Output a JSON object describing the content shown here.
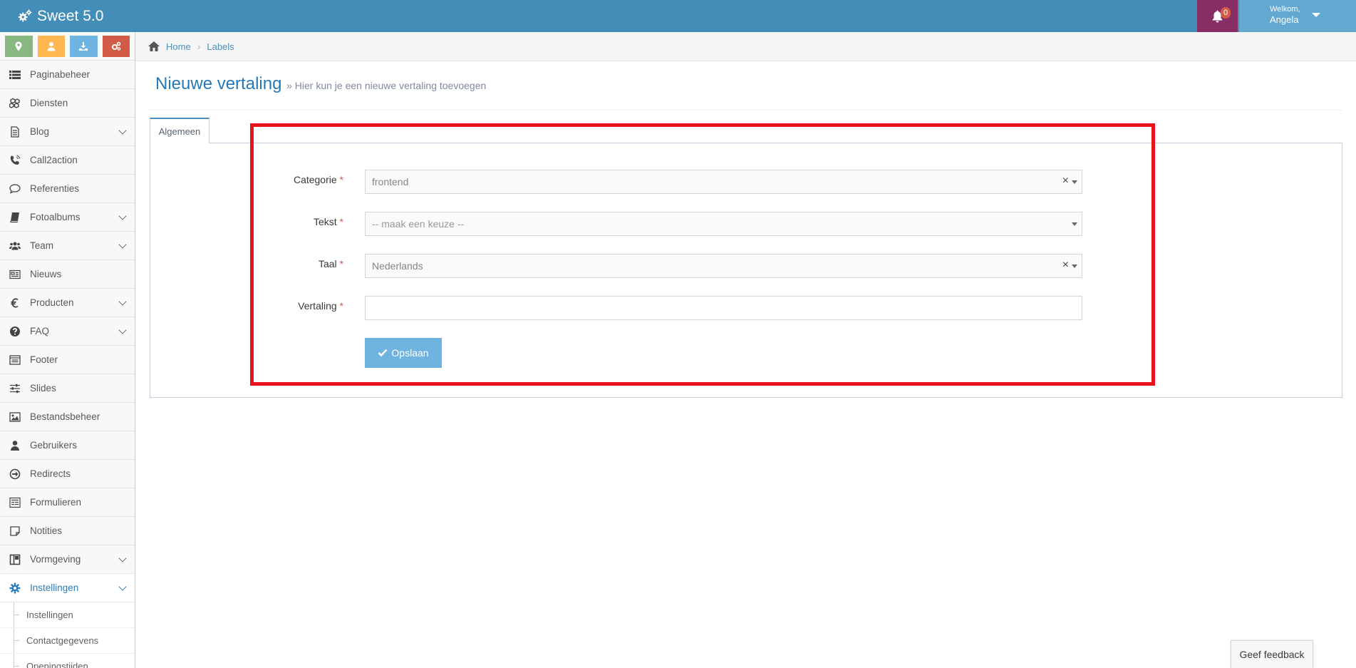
{
  "header": {
    "brand": "Sweet 5.0",
    "notification_count": "0",
    "welcome": "Welkom,",
    "user_name": "Angela"
  },
  "shortcuts": [
    {
      "icon": "map-marker-icon",
      "color": "#87b87f"
    },
    {
      "icon": "user-icon",
      "color": "#ffb752"
    },
    {
      "icon": "download-icon",
      "color": "#6fb3e0"
    },
    {
      "icon": "cogs-icon",
      "color": "#d15b47"
    }
  ],
  "sidebar": {
    "items": [
      {
        "label": "Paginabeheer",
        "icon": "list-icon",
        "has_submenu": false
      },
      {
        "label": "Diensten",
        "icon": "cubes-icon",
        "has_submenu": false
      },
      {
        "label": "Blog",
        "icon": "file-text-icon",
        "has_submenu": true
      },
      {
        "label": "Call2action",
        "icon": "phone-volume-icon",
        "has_submenu": false
      },
      {
        "label": "Referenties",
        "icon": "comment-icon",
        "has_submenu": false
      },
      {
        "label": "Fotoalbums",
        "icon": "book-icon",
        "has_submenu": true
      },
      {
        "label": "Team",
        "icon": "users-icon",
        "has_submenu": true
      },
      {
        "label": "Nieuws",
        "icon": "newspaper-icon",
        "has_submenu": false
      },
      {
        "label": "Producten",
        "icon": "euro-icon",
        "has_submenu": true
      },
      {
        "label": "FAQ",
        "icon": "question-circle-icon",
        "has_submenu": true
      },
      {
        "label": "Footer",
        "icon": "window-icon",
        "has_submenu": false
      },
      {
        "label": "Slides",
        "icon": "sliders-icon",
        "has_submenu": false
      },
      {
        "label": "Bestandsbeheer",
        "icon": "image-icon",
        "has_submenu": false
      },
      {
        "label": "Gebruikers",
        "icon": "user-icon",
        "has_submenu": false
      },
      {
        "label": "Redirects",
        "icon": "arrow-circle-icon",
        "has_submenu": false
      },
      {
        "label": "Formulieren",
        "icon": "form-icon",
        "has_submenu": false
      },
      {
        "label": "Notities",
        "icon": "sticky-note-icon",
        "has_submenu": false
      },
      {
        "label": "Vormgeving",
        "icon": "columns-icon",
        "has_submenu": true
      },
      {
        "label": "Instellingen",
        "icon": "gear-icon",
        "has_submenu": true,
        "active": true
      }
    ],
    "subitems": [
      "Instellingen",
      "Contactgegevens",
      "Openingstijden"
    ]
  },
  "breadcrumb": {
    "home": "Home",
    "current": "Labels"
  },
  "page": {
    "title": "Nieuwe vertaling",
    "subtitle": "» Hier kun je een nieuwe vertaling toevoegen"
  },
  "tabs": [
    {
      "label": "Algemeen"
    }
  ],
  "form": {
    "categorie": {
      "label": "Categorie",
      "value": "frontend"
    },
    "tekst": {
      "label": "Tekst",
      "placeholder": "-- maak een keuze --"
    },
    "taal": {
      "label": "Taal",
      "value": "Nederlands"
    },
    "vertaling": {
      "label": "Vertaling",
      "value": ""
    },
    "required_mark": "*",
    "save_label": "Opslaan"
  },
  "feedback_label": "Geef feedback",
  "colors": {
    "header": "#438eb9",
    "notification": "#892e65",
    "user": "#62a8d1",
    "link": "#4c8fbd",
    "highlight": "#e8141b",
    "save_button": "#6fb3e0"
  }
}
